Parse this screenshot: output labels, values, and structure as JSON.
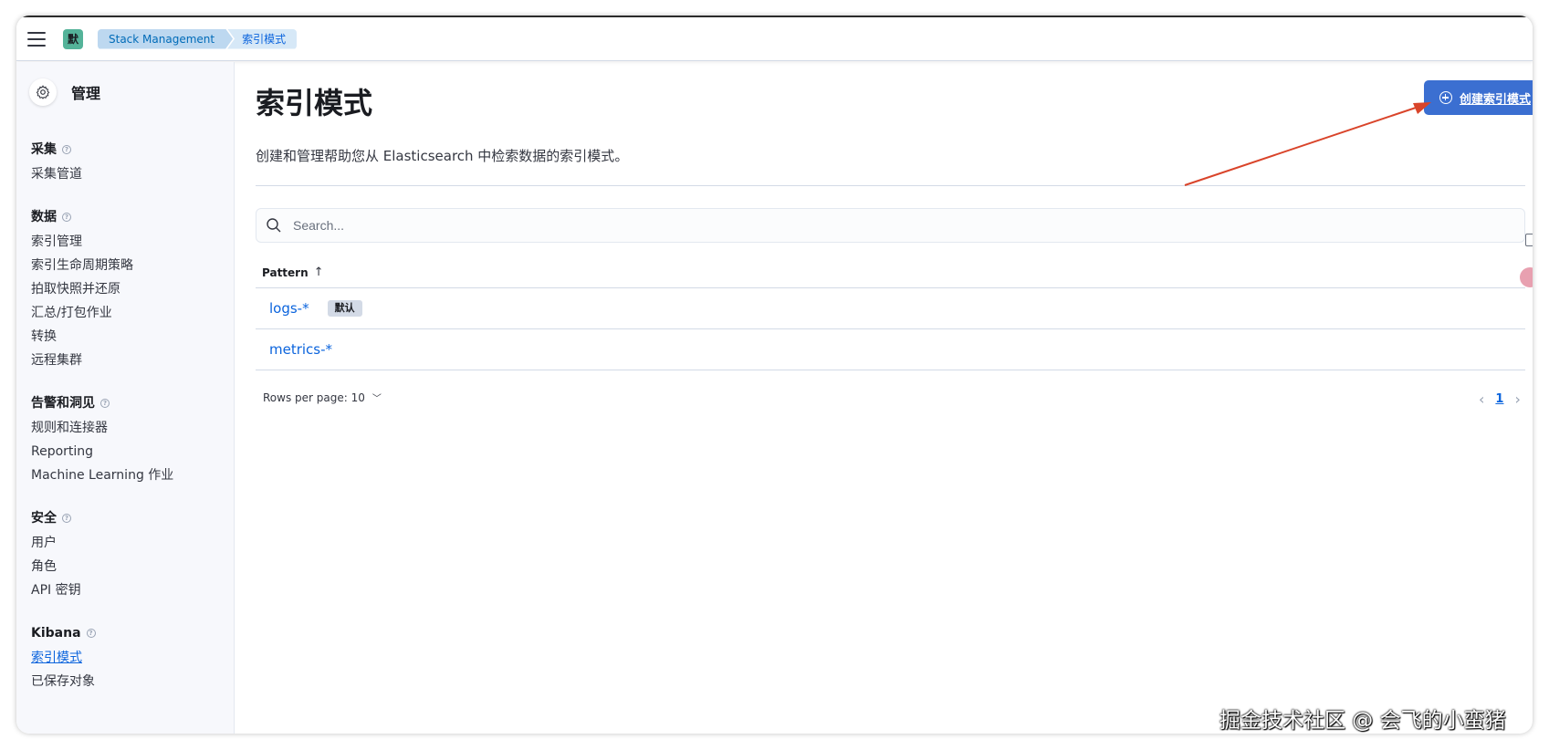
{
  "header": {
    "space_initial": "默",
    "breadcrumbs": [
      "Stack Management",
      "索引模式"
    ]
  },
  "sidebar": {
    "title": "管理",
    "groups": [
      {
        "heading": "采集",
        "items": [
          "采集管道"
        ]
      },
      {
        "heading": "数据",
        "items": [
          "索引管理",
          "索引生命周期策略",
          "拍取快照并还原",
          "汇总/打包作业",
          "转换",
          "远程集群"
        ]
      },
      {
        "heading": "告警和洞见",
        "items": [
          "规则和连接器",
          "Reporting",
          "Machine Learning 作业"
        ]
      },
      {
        "heading": "安全",
        "items": [
          "用户",
          "角色",
          "API 密钥"
        ]
      },
      {
        "heading": "Kibana",
        "items": [
          "索引模式",
          "已保存对象"
        ]
      }
    ],
    "active_item": "索引模式"
  },
  "main": {
    "title": "索引模式",
    "description": "创建和管理帮助您从 Elasticsearch 中检索数据的索引模式。",
    "create_button": "创建索引模式",
    "search_placeholder": "Search...",
    "table": {
      "column": "Pattern",
      "sort": "ascending",
      "rows": [
        {
          "pattern": "logs-*",
          "badge": "默认"
        },
        {
          "pattern": "metrics-*",
          "badge": ""
        }
      ]
    },
    "rows_per_page": "Rows per page: 10",
    "pagination": {
      "current_page": "1"
    }
  },
  "watermark": "掘金技术社区 @ 会飞的小蛮猪",
  "colors": {
    "accent": "#3b6fd1",
    "link": "#0b64dd",
    "space_avatar": "#54b399",
    "annotation_arrow": "#d9442a"
  }
}
